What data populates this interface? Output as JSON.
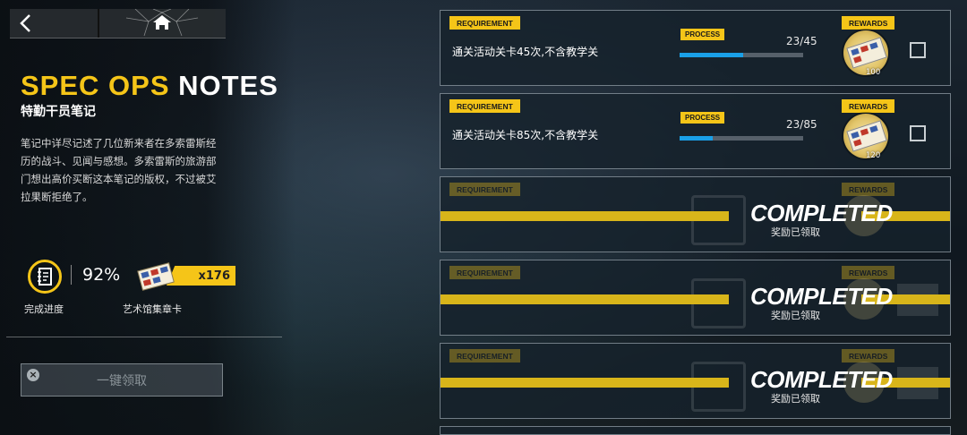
{
  "nav": {
    "back_label": "",
    "home_label": ""
  },
  "header": {
    "title_en_yellow": "SPEC OPS",
    "title_en_white": " NOTES",
    "title_cn": "特勤干员笔记"
  },
  "description": "笔记中详尽记述了几位新来者在多索雷斯经历的战斗、见闻与感想。多索雷斯的旅游部门想出高价买断这本笔记的版权，不过被艾拉果断拒绝了。",
  "progress": {
    "percent": "92%",
    "label": "完成进度"
  },
  "collect_card": {
    "count": "x176",
    "label": "艺术馆集章卡"
  },
  "claim_all_button": {
    "label": "一键领取",
    "icon": "close-icon"
  },
  "tags": {
    "requirement": "REQUIREMENT",
    "process": "PROCESS",
    "rewards": "REWARDS"
  },
  "tasks": [
    {
      "requirement": "通关活动关卡45次,不含教学关",
      "count": "23/45",
      "progress": 0.511,
      "reward_qty": "100",
      "status": "active"
    },
    {
      "requirement": "通关活动关卡85次,不含教学关",
      "count": "23/85",
      "progress": 0.271,
      "reward_qty": "120",
      "status": "active"
    },
    {
      "completed_text": "COMPLETED",
      "claimed_text": "奖励已领取",
      "status": "completed"
    },
    {
      "completed_text": "COMPLETED",
      "claimed_text": "奖励已领取",
      "status": "completed"
    },
    {
      "completed_text": "COMPLETED",
      "claimed_text": "奖励已领取",
      "status": "completed"
    }
  ],
  "colors": {
    "accent": "#f5c518",
    "progress_bar": "#1aa0e8"
  }
}
